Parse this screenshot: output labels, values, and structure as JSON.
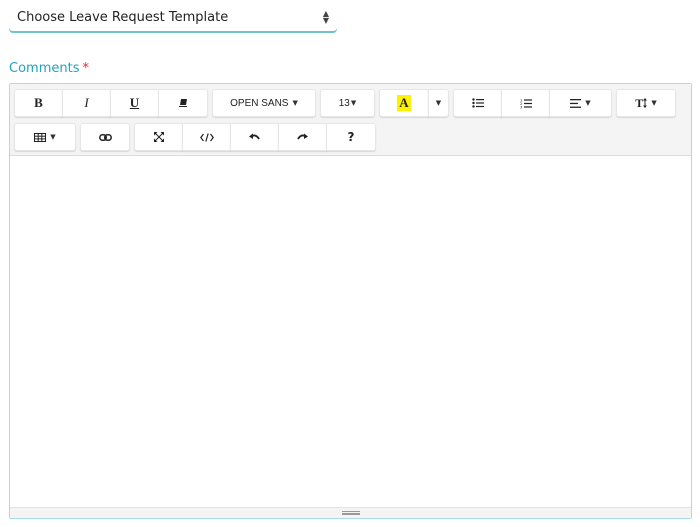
{
  "template_select": {
    "value": "Choose Leave Request Template",
    "arrows": [
      "▲",
      "▼"
    ]
  },
  "comments": {
    "label": "Comments",
    "required_mark": "*"
  },
  "toolbar": {
    "bold": "B",
    "italic": "I",
    "underline": "U",
    "font_family": "OPEN SANS",
    "font_size": "13",
    "color_letter": "A",
    "text_height": "T",
    "help": "?",
    "caret": "▼"
  },
  "colors": {
    "accent": "#22a3c3",
    "required": "#e0262b",
    "highlight": "#fff200",
    "editor_border": "#a7dde5"
  }
}
